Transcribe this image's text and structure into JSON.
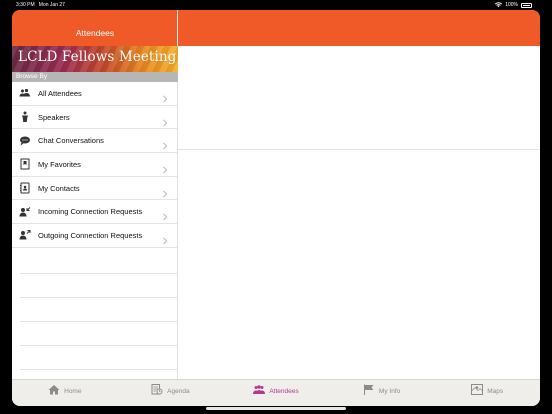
{
  "status_bar": {
    "time": "3:30 PM",
    "date": "Mon Jan 27",
    "battery": "100%",
    "wifi_icon": "wifi-icon",
    "battery_icon": "battery-icon"
  },
  "header": {
    "title": "Attendees",
    "accent_color": "#f05a28"
  },
  "banner": {
    "text": "LCLD Fellows Meeting"
  },
  "sidebar": {
    "section_title": "Browse By",
    "items": [
      {
        "label": "All Attendees",
        "icon": "people-group-icon"
      },
      {
        "label": "Speakers",
        "icon": "speaker-podium-icon"
      },
      {
        "label": "Chat Conversations",
        "icon": "chat-bubble-icon"
      },
      {
        "label": "My Favorites",
        "icon": "bookmark-favorite-icon"
      },
      {
        "label": "My Contacts",
        "icon": "address-book-icon"
      },
      {
        "label": "Incoming Connection Requests",
        "icon": "incoming-request-icon"
      },
      {
        "label": "Outgoing Connection Requests",
        "icon": "outgoing-request-icon"
      }
    ]
  },
  "tabbar": {
    "active_color": "#b23a8e",
    "tabs": [
      {
        "label": "Home",
        "icon": "home-icon"
      },
      {
        "label": "Agenda",
        "icon": "agenda-icon"
      },
      {
        "label": "Attendees",
        "icon": "attendees-icon",
        "active": true
      },
      {
        "label": "My Info",
        "icon": "flag-icon"
      },
      {
        "label": "Maps",
        "icon": "map-icon"
      }
    ]
  }
}
